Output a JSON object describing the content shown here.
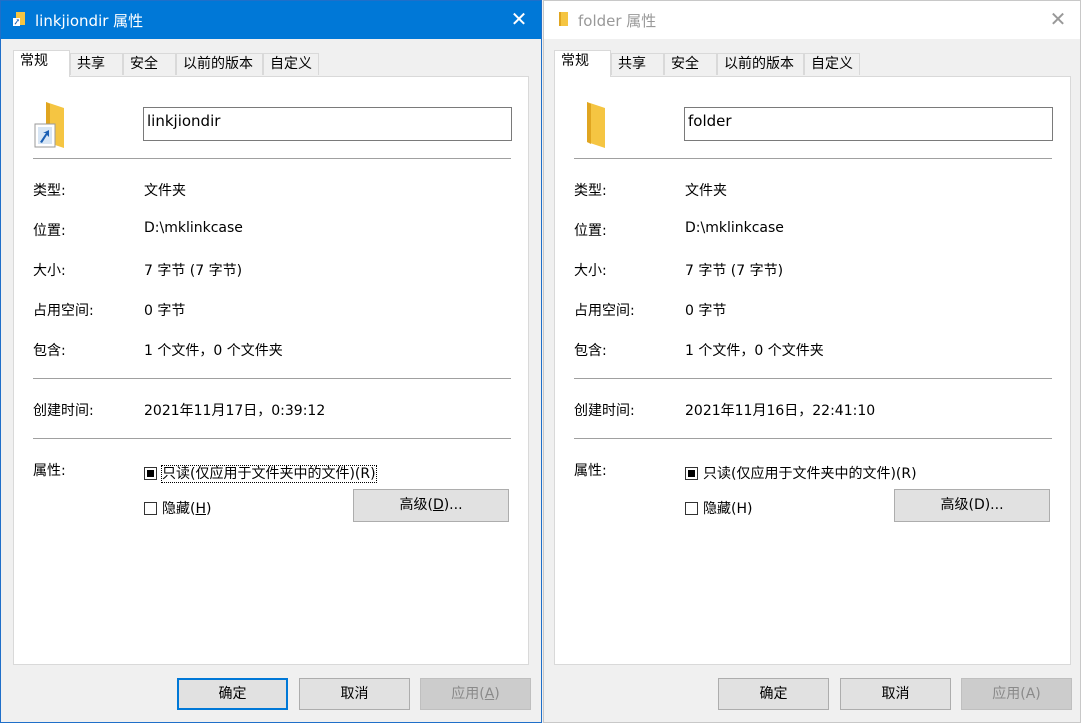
{
  "colors": {
    "titlebar_active": "#0078d7",
    "focus_border": "#0078d7"
  },
  "tabs": [
    "常规",
    "共享",
    "安全",
    "以前的版本",
    "自定义"
  ],
  "labels": {
    "type": "类型:",
    "location": "位置:",
    "size": "大小:",
    "size_on_disk": "占用空间:",
    "contains": "包含:",
    "created": "创建时间:",
    "attributes": "属性:"
  },
  "checkbox_readonly": "只读(仅应用于文件夹中的文件)(R)",
  "checkbox_hidden_text": "隐藏(",
  "checkbox_hidden_key": "H",
  "checkbox_hidden_end": ")",
  "advanced_text": "高级(",
  "advanced_key": "D",
  "advanced_end": ")...",
  "buttons": {
    "ok": "确定",
    "cancel": "取消",
    "apply_text": "应用(",
    "apply_key": "A",
    "apply_end": ")"
  },
  "left": {
    "title": "linkjiondir 属性",
    "name": "linkjiondir",
    "type": "文件夹",
    "location": "D:\\mklinkcase",
    "size": "7 字节 (7 字节)",
    "size_on_disk": "0 字节",
    "contains": "1 个文件，0 个文件夹",
    "created": "2021年11月17日，0:39:12"
  },
  "right": {
    "title": "folder 属性",
    "name": "folder",
    "type": "文件夹",
    "location": "D:\\mklinkcase",
    "size": "7 字节 (7 字节)",
    "size_on_disk": "0 字节",
    "contains": "1 个文件，0 个文件夹",
    "created": "2021年11月16日，22:41:10"
  }
}
